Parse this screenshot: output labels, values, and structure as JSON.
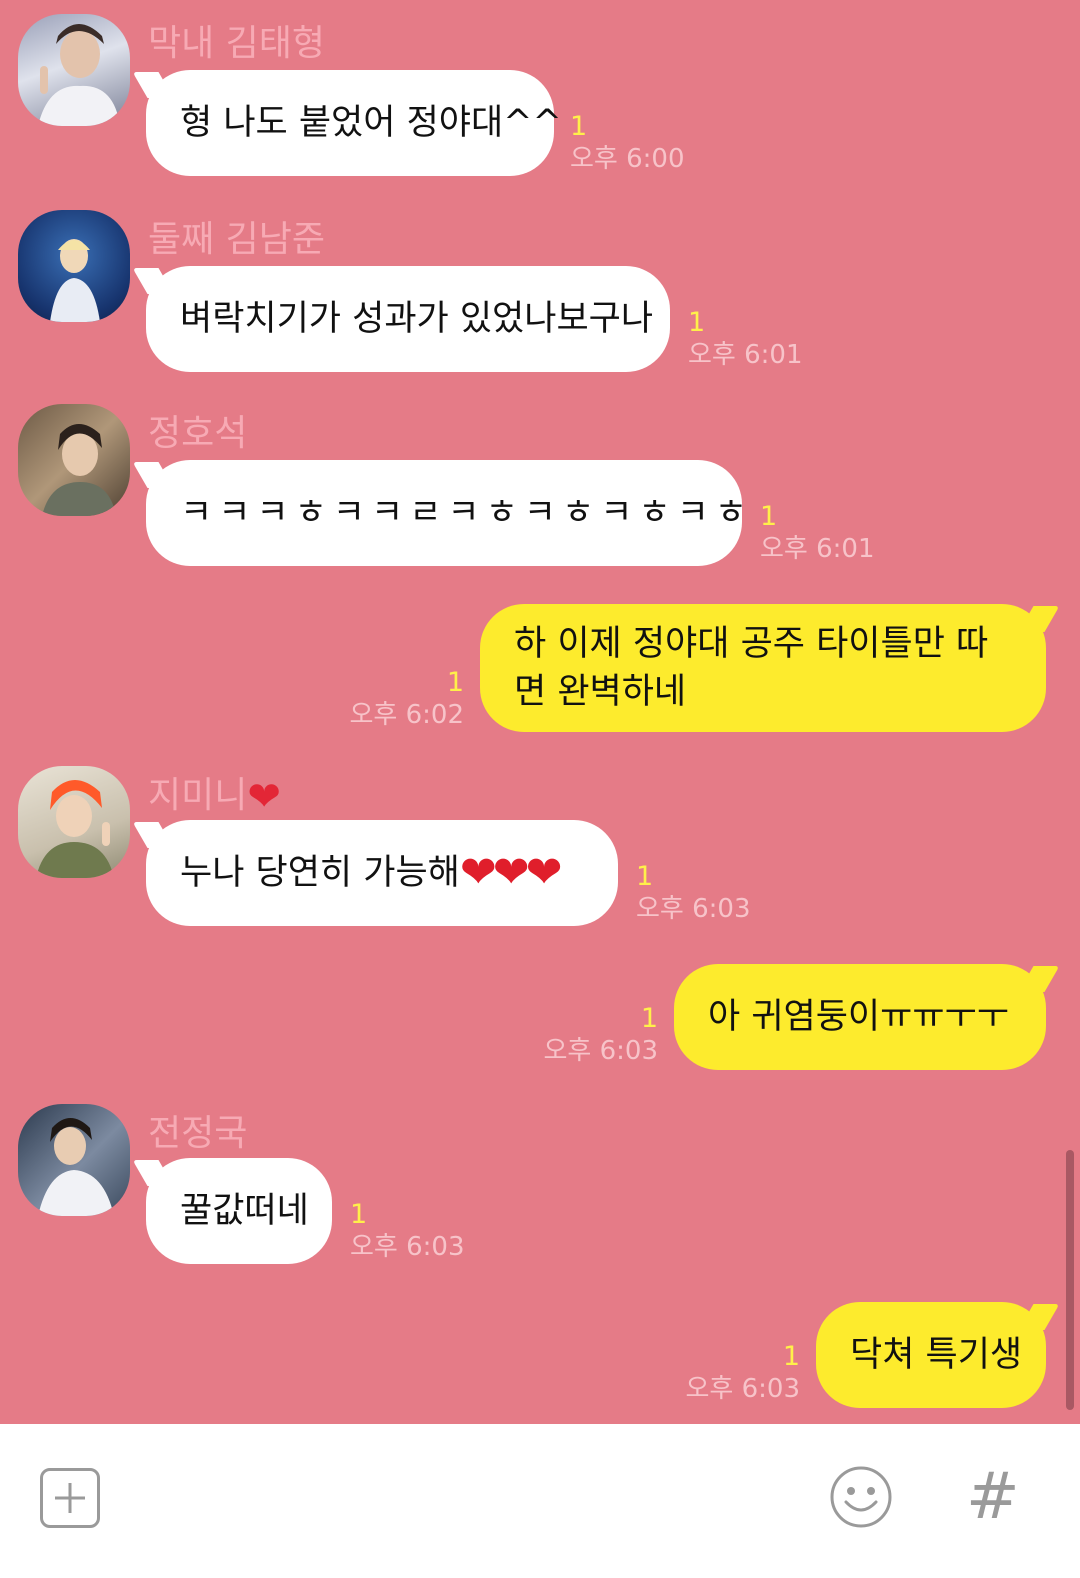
{
  "messages": [
    {
      "sender": "막내 김태형",
      "text": "형 나도 붙었어 정야대^^",
      "count": "1",
      "time": "오후 6:00"
    },
    {
      "sender": "둘째 김남준",
      "text": "벼락치기가 성과가 있었나보구나",
      "count": "1",
      "time": "오후 6:01"
    },
    {
      "sender": "정호석",
      "text": "ㅋㅋㅋㅎㅋㅋㄹㅋㅎㅋㅎㅋㅎㅋㅎ",
      "count": "1",
      "time": "오후 6:01"
    },
    {
      "text": "하 이제 정야대 공주 타이틀만 따면 완벽하네",
      "count": "1",
      "time": "오후 6:02"
    },
    {
      "sender": "지미니",
      "sender_emoji": "❤",
      "text": "누나 당연히 가능해",
      "text_emoji": "❤❤❤",
      "count": "1",
      "time": "오후 6:03"
    },
    {
      "text": "아 귀염둥이ㅠㅠㅜㅜ",
      "count": "1",
      "time": "오후 6:03"
    },
    {
      "sender": "전정국",
      "text": "꿀값떠네",
      "count": "1",
      "time": "오후 6:03"
    },
    {
      "text": "닥쳐 특기생",
      "count": "1",
      "time": "오후 6:03"
    }
  ],
  "input_bar": {
    "add_icon": "plus-square-icon",
    "emoji_icon": "smiley-icon",
    "hashtag_label": "#"
  },
  "colors": {
    "background": "#e57b87",
    "incoming_bubble": "#ffffff",
    "outgoing_bubble": "#fdeb2d",
    "unread_count": "#fff04a",
    "name_text": "#f7aab4"
  }
}
